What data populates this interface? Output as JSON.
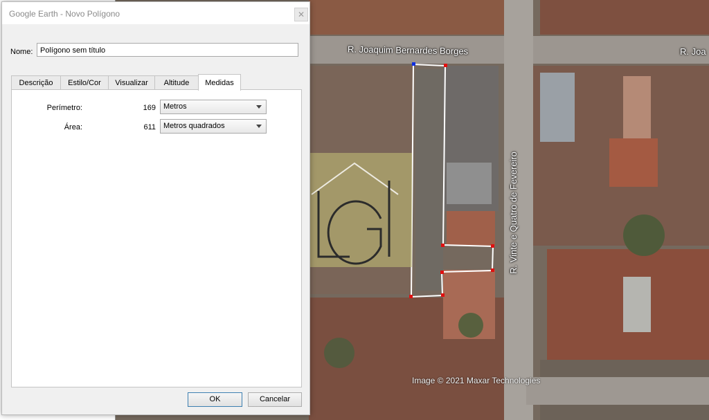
{
  "dialog": {
    "title": "Google Earth - Novo Polígono",
    "name_label": "Nome:",
    "name_value": "Polígono sem título",
    "tabs": [
      {
        "label": "Descrição"
      },
      {
        "label": "Estilo/Cor"
      },
      {
        "label": "Visualizar"
      },
      {
        "label": "Altitude"
      },
      {
        "label": "Medidas"
      }
    ],
    "active_tab": "Medidas",
    "measurements": {
      "perimeter_label": "Perímetro:",
      "perimeter_value": "169",
      "perimeter_unit": "Metros",
      "area_label": "Área:",
      "area_value": "611",
      "area_unit": "Metros quadrados"
    },
    "ok_label": "OK",
    "cancel_label": "Cancelar"
  },
  "map": {
    "street_top": "R. Joaquim Bernardes Borges",
    "street_top_right": "R. Joa",
    "street_vertical": "R. Vinte e Quatro de Fevereiro",
    "attribution": "Image © 2021 Maxar Technologies"
  },
  "colors": {
    "polygon_outline": "#ffffff",
    "vertex": "#e01010",
    "vertex_selected": "#1030e0",
    "ok_border": "#3c7fb1"
  }
}
